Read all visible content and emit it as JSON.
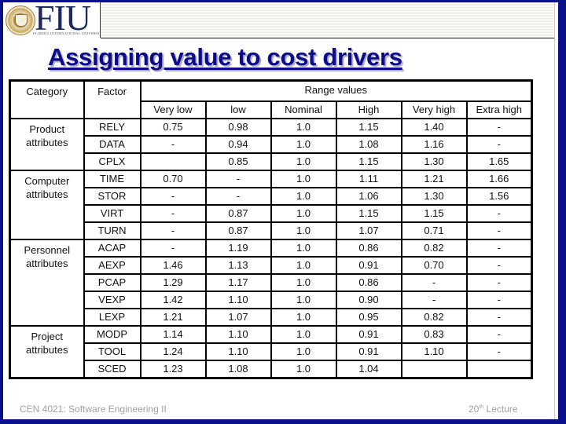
{
  "header": {
    "logo_text": "FIU",
    "logo_subtitle": "FLORIDA INTERNATIONAL UNIVERSITY"
  },
  "slide": {
    "title": "Assigning value to cost drivers"
  },
  "table": {
    "header": {
      "category": "Category",
      "factor": "Factor",
      "range_values": "Range values",
      "levels": [
        "Very low",
        "low",
        "Nominal",
        "High",
        "Very high",
        "Extra high"
      ]
    },
    "groups": [
      {
        "category_line1": "Product",
        "category_line2": "attributes",
        "rows": [
          {
            "factor": "RELY",
            "values": [
              "0.75",
              "0.98",
              "1.0",
              "1.15",
              "1.40",
              "-"
            ]
          },
          {
            "factor": "DATA",
            "values": [
              "-",
              "0.94",
              "1.0",
              "1.08",
              "1.16",
              "-"
            ]
          },
          {
            "factor": "CPLX",
            "values": [
              "",
              "0.85",
              "1.0",
              "1.15",
              "1.30",
              "1.65"
            ]
          }
        ]
      },
      {
        "category_line1": "Computer",
        "category_line2": "attributes",
        "rows": [
          {
            "factor": "TIME",
            "values": [
              "0.70",
              "-",
              "1.0",
              "1.11",
              "1.21",
              "1.66"
            ]
          },
          {
            "factor": "STOR",
            "values": [
              "-",
              "-",
              "1.0",
              "1.06",
              "1.30",
              "1.56"
            ]
          },
          {
            "factor": "VIRT",
            "values": [
              "-",
              "0.87",
              "1.0",
              "1.15",
              "1.15",
              "-"
            ]
          },
          {
            "factor": "TURN",
            "values": [
              "-",
              "0.87",
              "1.0",
              "1.07",
              "0.71",
              "-"
            ]
          }
        ]
      },
      {
        "category_line1": "Personnel",
        "category_line2": "attributes",
        "rows": [
          {
            "factor": "ACAP",
            "values": [
              "-",
              "1.19",
              "1.0",
              "0.86",
              "0.82",
              "-"
            ]
          },
          {
            "factor": "AEXP",
            "values": [
              "1.46",
              "1.13",
              "1.0",
              "0.91",
              "0.70",
              "-"
            ]
          },
          {
            "factor": "PCAP",
            "values": [
              "1.29",
              "1.17",
              "1.0",
              "0.86",
              "-",
              "-"
            ]
          },
          {
            "factor": "VEXP",
            "values": [
              "1.42",
              "1.10",
              "1.0",
              "0.90",
              "-",
              "-"
            ]
          },
          {
            "factor": "LEXP",
            "values": [
              "1.21",
              "1.07",
              "1.0",
              "0.95",
              "0.82",
              "-"
            ]
          }
        ]
      },
      {
        "category_line1": "Project",
        "category_line2": "attributes",
        "rows": [
          {
            "factor": "MODP",
            "values": [
              "1.14",
              "1.10",
              "1.0",
              "0.91",
              "0.83",
              "-"
            ]
          },
          {
            "factor": "TOOL",
            "values": [
              "1.24",
              "1.10",
              "1.0",
              "0.91",
              "1.10",
              "-"
            ]
          },
          {
            "factor": "SCED",
            "values": [
              "1.23",
              "1.08",
              "1.0",
              "1.04",
              "",
              ""
            ]
          }
        ]
      }
    ]
  },
  "footer": {
    "course": "CEN 4021: Software Engineering II",
    "lecture_number": "20",
    "lecture_suffix": "th",
    "lecture_word": " Lecture"
  }
}
